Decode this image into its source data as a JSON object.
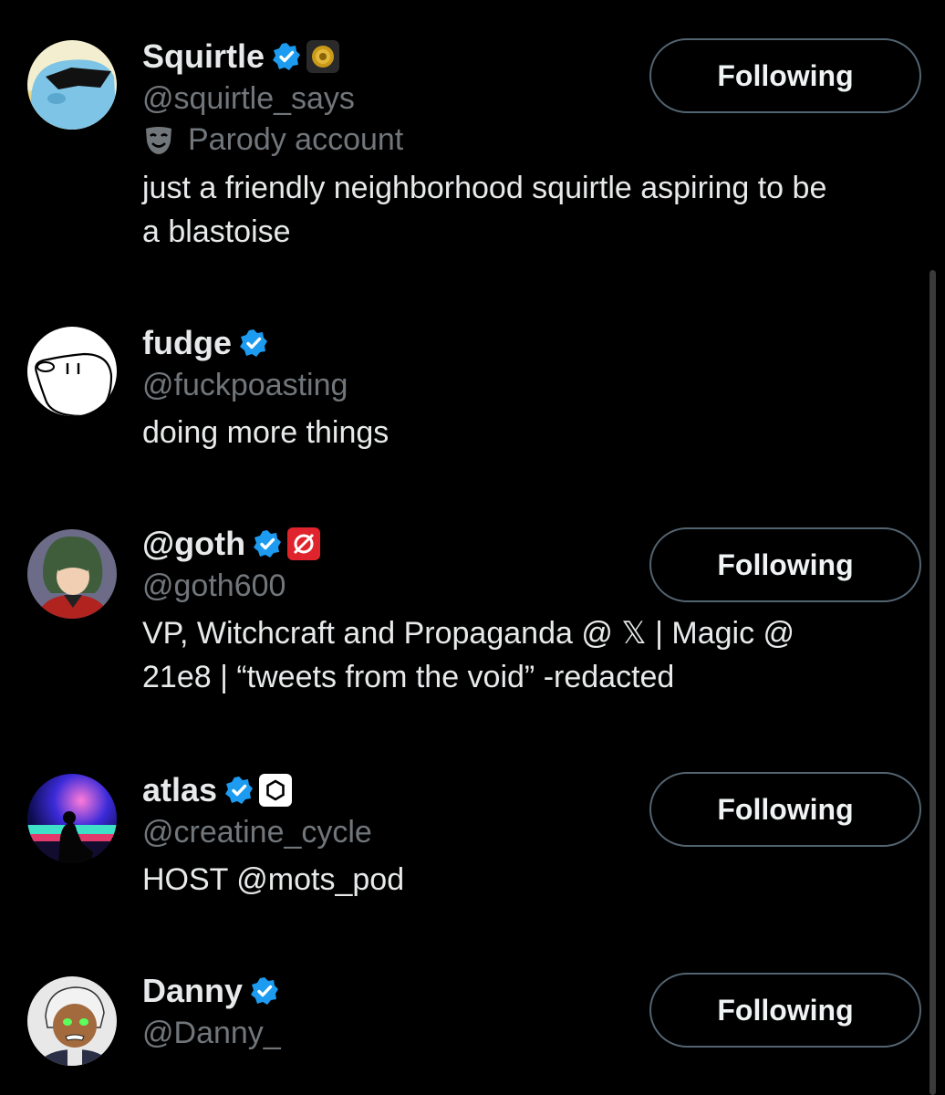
{
  "users": [
    {
      "display_name": "Squirtle",
      "handle": "@squirtle_says",
      "parody_label": "Parody account",
      "bio_lines": [
        "just a friendly neighborhood squirtle aspiring to be",
        "a blastoise"
      ],
      "button_label": "Following",
      "verified_icon": "verified-badge-icon",
      "affiliate_icon": "gold-coin-badge-icon"
    },
    {
      "display_name": "fudge",
      "handle": "@fuckpoasting",
      "bio_lines": [
        "doing more things"
      ],
      "verified_icon": "verified-badge-icon"
    },
    {
      "display_name": "@goth",
      "handle": "@goth600",
      "bio_lines": [
        "VP, Witchcraft and Propaganda @ 𝕏 | Magic @",
        "21e8 | “tweets from the void” -redacted"
      ],
      "button_label": "Following",
      "verified_icon": "verified-badge-icon",
      "affiliate_icon": "red-null-badge-icon"
    },
    {
      "display_name": "atlas",
      "handle": "@creatine_cycle",
      "bio_lines": [
        "HOST @mots_pod"
      ],
      "button_label": "Following",
      "verified_icon": "verified-badge-icon",
      "affiliate_icon": "hexagon-badge-icon"
    },
    {
      "display_name": "Danny",
      "handle": "@Danny_",
      "button_label": "Following",
      "verified_icon": "verified-badge-icon"
    }
  ],
  "colors": {
    "background": "#000000",
    "primary_text": "#e7e9ea",
    "secondary_text": "#71767b",
    "verified_blue": "#1d9bf0",
    "button_border": "#536471"
  }
}
